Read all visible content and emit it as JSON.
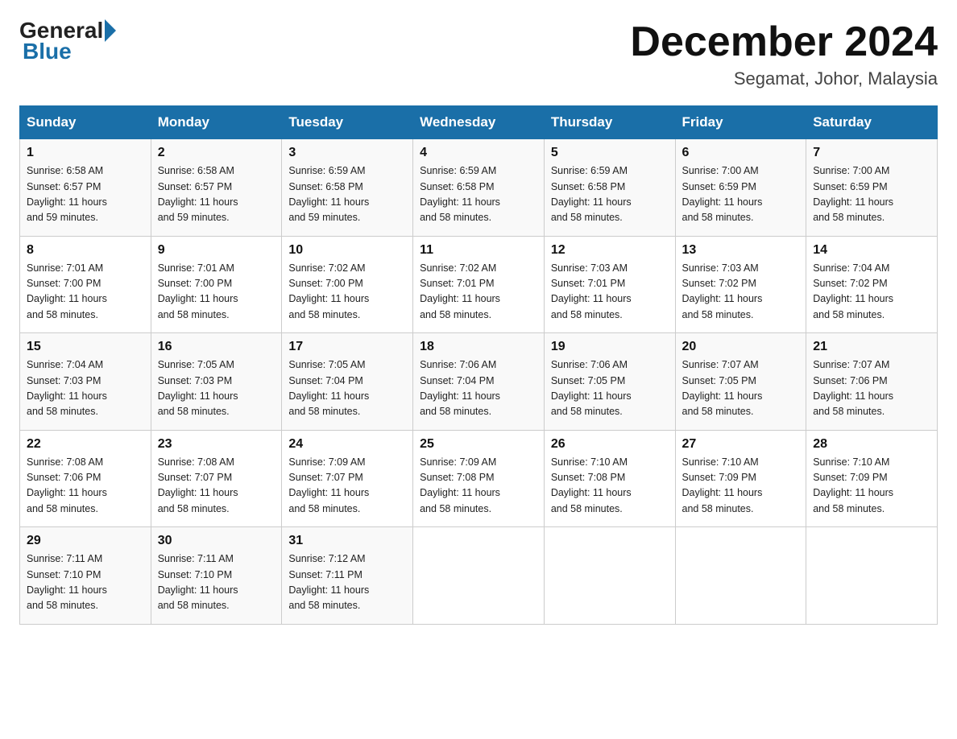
{
  "header": {
    "logo_general": "General",
    "logo_blue": "Blue",
    "month_title": "December 2024",
    "location": "Segamat, Johor, Malaysia"
  },
  "days_of_week": [
    "Sunday",
    "Monday",
    "Tuesday",
    "Wednesday",
    "Thursday",
    "Friday",
    "Saturday"
  ],
  "weeks": [
    [
      {
        "day": "1",
        "sunrise": "6:58 AM",
        "sunset": "6:57 PM",
        "daylight": "11 hours and 59 minutes."
      },
      {
        "day": "2",
        "sunrise": "6:58 AM",
        "sunset": "6:57 PM",
        "daylight": "11 hours and 59 minutes."
      },
      {
        "day": "3",
        "sunrise": "6:59 AM",
        "sunset": "6:58 PM",
        "daylight": "11 hours and 59 minutes."
      },
      {
        "day": "4",
        "sunrise": "6:59 AM",
        "sunset": "6:58 PM",
        "daylight": "11 hours and 58 minutes."
      },
      {
        "day": "5",
        "sunrise": "6:59 AM",
        "sunset": "6:58 PM",
        "daylight": "11 hours and 58 minutes."
      },
      {
        "day": "6",
        "sunrise": "7:00 AM",
        "sunset": "6:59 PM",
        "daylight": "11 hours and 58 minutes."
      },
      {
        "day": "7",
        "sunrise": "7:00 AM",
        "sunset": "6:59 PM",
        "daylight": "11 hours and 58 minutes."
      }
    ],
    [
      {
        "day": "8",
        "sunrise": "7:01 AM",
        "sunset": "7:00 PM",
        "daylight": "11 hours and 58 minutes."
      },
      {
        "day": "9",
        "sunrise": "7:01 AM",
        "sunset": "7:00 PM",
        "daylight": "11 hours and 58 minutes."
      },
      {
        "day": "10",
        "sunrise": "7:02 AM",
        "sunset": "7:00 PM",
        "daylight": "11 hours and 58 minutes."
      },
      {
        "day": "11",
        "sunrise": "7:02 AM",
        "sunset": "7:01 PM",
        "daylight": "11 hours and 58 minutes."
      },
      {
        "day": "12",
        "sunrise": "7:03 AM",
        "sunset": "7:01 PM",
        "daylight": "11 hours and 58 minutes."
      },
      {
        "day": "13",
        "sunrise": "7:03 AM",
        "sunset": "7:02 PM",
        "daylight": "11 hours and 58 minutes."
      },
      {
        "day": "14",
        "sunrise": "7:04 AM",
        "sunset": "7:02 PM",
        "daylight": "11 hours and 58 minutes."
      }
    ],
    [
      {
        "day": "15",
        "sunrise": "7:04 AM",
        "sunset": "7:03 PM",
        "daylight": "11 hours and 58 minutes."
      },
      {
        "day": "16",
        "sunrise": "7:05 AM",
        "sunset": "7:03 PM",
        "daylight": "11 hours and 58 minutes."
      },
      {
        "day": "17",
        "sunrise": "7:05 AM",
        "sunset": "7:04 PM",
        "daylight": "11 hours and 58 minutes."
      },
      {
        "day": "18",
        "sunrise": "7:06 AM",
        "sunset": "7:04 PM",
        "daylight": "11 hours and 58 minutes."
      },
      {
        "day": "19",
        "sunrise": "7:06 AM",
        "sunset": "7:05 PM",
        "daylight": "11 hours and 58 minutes."
      },
      {
        "day": "20",
        "sunrise": "7:07 AM",
        "sunset": "7:05 PM",
        "daylight": "11 hours and 58 minutes."
      },
      {
        "day": "21",
        "sunrise": "7:07 AM",
        "sunset": "7:06 PM",
        "daylight": "11 hours and 58 minutes."
      }
    ],
    [
      {
        "day": "22",
        "sunrise": "7:08 AM",
        "sunset": "7:06 PM",
        "daylight": "11 hours and 58 minutes."
      },
      {
        "day": "23",
        "sunrise": "7:08 AM",
        "sunset": "7:07 PM",
        "daylight": "11 hours and 58 minutes."
      },
      {
        "day": "24",
        "sunrise": "7:09 AM",
        "sunset": "7:07 PM",
        "daylight": "11 hours and 58 minutes."
      },
      {
        "day": "25",
        "sunrise": "7:09 AM",
        "sunset": "7:08 PM",
        "daylight": "11 hours and 58 minutes."
      },
      {
        "day": "26",
        "sunrise": "7:10 AM",
        "sunset": "7:08 PM",
        "daylight": "11 hours and 58 minutes."
      },
      {
        "day": "27",
        "sunrise": "7:10 AM",
        "sunset": "7:09 PM",
        "daylight": "11 hours and 58 minutes."
      },
      {
        "day": "28",
        "sunrise": "7:10 AM",
        "sunset": "7:09 PM",
        "daylight": "11 hours and 58 minutes."
      }
    ],
    [
      {
        "day": "29",
        "sunrise": "7:11 AM",
        "sunset": "7:10 PM",
        "daylight": "11 hours and 58 minutes."
      },
      {
        "day": "30",
        "sunrise": "7:11 AM",
        "sunset": "7:10 PM",
        "daylight": "11 hours and 58 minutes."
      },
      {
        "day": "31",
        "sunrise": "7:12 AM",
        "sunset": "7:11 PM",
        "daylight": "11 hours and 58 minutes."
      },
      null,
      null,
      null,
      null
    ]
  ],
  "labels": {
    "sunrise": "Sunrise:",
    "sunset": "Sunset:",
    "daylight": "Daylight:"
  }
}
